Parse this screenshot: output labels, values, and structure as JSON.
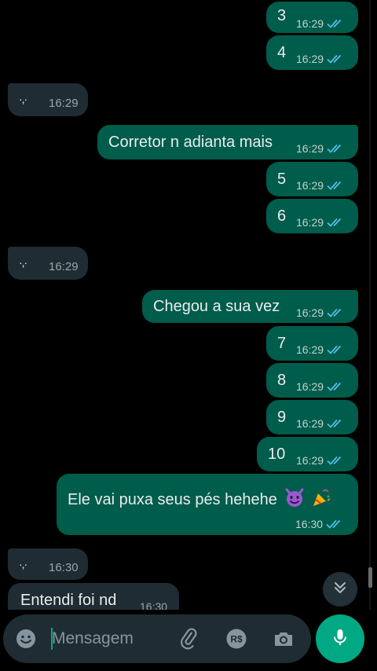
{
  "messages": [
    {
      "text": "3",
      "time": "16:29"
    },
    {
      "text": "4",
      "time": "16:29"
    },
    {
      "text": "·,·",
      "time": "16:29"
    },
    {
      "text": "Corretor n adianta mais",
      "time": "16:29"
    },
    {
      "text": "5",
      "time": "16:29"
    },
    {
      "text": "6",
      "time": "16:29"
    },
    {
      "text": "·,·",
      "time": "16:29"
    },
    {
      "text": "Chegou a sua vez",
      "time": "16:29"
    },
    {
      "text": "7",
      "time": "16:29"
    },
    {
      "text": "8",
      "time": "16:29"
    },
    {
      "text": "9",
      "time": "16:29"
    },
    {
      "text": "10",
      "time": "16:29"
    },
    {
      "text": "Ele vai puxa seus pés hehehe",
      "time": "16:30"
    },
    {
      "text": "·,·",
      "time": "16:30"
    },
    {
      "text": "Entendi foi nd",
      "time": "16:30"
    }
  ],
  "composer": {
    "placeholder": "Mensagem"
  },
  "icons": {
    "emoji": "emoji-icon",
    "attach": "paperclip-icon",
    "payment": "real-currency-icon",
    "camera": "camera-icon",
    "mic": "microphone-icon",
    "scroll_down": "chevron-double-down-icon",
    "read": "double-check-icon"
  },
  "colors": {
    "outgoing_bubble": "#005c4b",
    "incoming_bubble": "#1f2c33",
    "read_ticks": "#53bdeb",
    "accent": "#00a884"
  }
}
